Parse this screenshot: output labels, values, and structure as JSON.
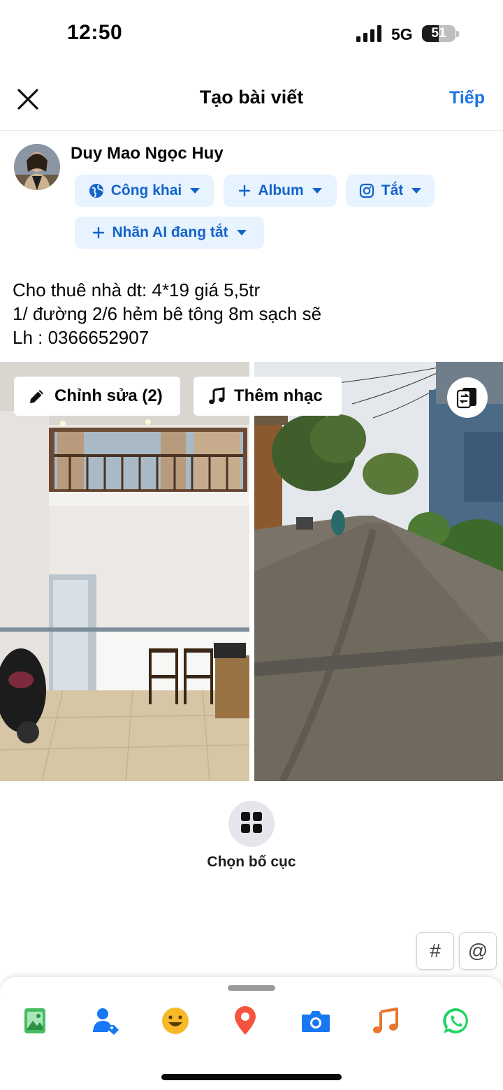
{
  "status": {
    "time": "12:50",
    "network": "5G",
    "battery": "51",
    "battery_level": 0.51
  },
  "header": {
    "title": "Tạo bài viết",
    "next_label": "Tiếp"
  },
  "user": {
    "name": "Duy Mao Ngọc Huy"
  },
  "chips": {
    "privacy": "Công khai",
    "album": "Album",
    "instagram": "Tắt",
    "ai_label": "Nhãn AI đang tắt"
  },
  "post": {
    "lines": [
      "Cho thuê nhà dt: 4*19 giá 5,5tr",
      "1/ đường 2/6 hẻm bê tông 8m sạch sẽ",
      "Lh : 0366652907"
    ]
  },
  "photos": {
    "edit_label": "Chỉnh sửa (2)",
    "music_label": "Thêm nhạc"
  },
  "layout": {
    "label": "Chọn bố cục"
  },
  "shortcuts": {
    "hashtag": "#",
    "mention": "@"
  },
  "toolbar": {
    "icons": [
      "photo-icon",
      "tag-people-icon",
      "feeling-icon",
      "location-icon",
      "camera-icon",
      "music-icon",
      "whatsapp-icon"
    ]
  },
  "colors": {
    "accent": "#1b74e4",
    "chip_bg": "#e7f3ff",
    "chip_text": "#1464c8"
  }
}
